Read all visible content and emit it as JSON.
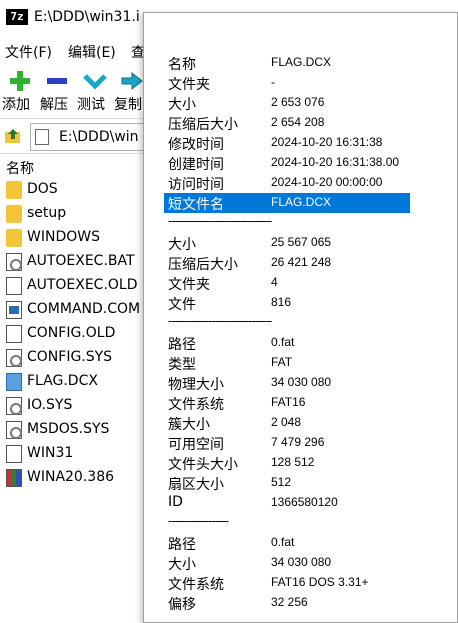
{
  "window": {
    "icon_text": "7z",
    "title": "E:\\DDD\\win31.i"
  },
  "menu": [
    "文件(F)",
    "编辑(E)",
    "查"
  ],
  "toolbar": [
    {
      "label": "添加",
      "icon": "add-icon",
      "color": "#2db52d"
    },
    {
      "label": "解压",
      "icon": "extract-icon",
      "color": "#2a3fc9"
    },
    {
      "label": "测试",
      "icon": "test-icon",
      "color": "#19a7c9"
    },
    {
      "label": "复制",
      "icon": "copy-icon",
      "color": "#19a7c9"
    }
  ],
  "address": {
    "path": "E:\\DDD\\win"
  },
  "filelist": {
    "header": "名称",
    "items": [
      {
        "name": "DOS",
        "icon": "folder-icon"
      },
      {
        "name": "setup",
        "icon": "folder-icon"
      },
      {
        "name": "WINDOWS",
        "icon": "folder-icon"
      },
      {
        "name": "AUTOEXEC.BAT",
        "icon": "settings-file-icon"
      },
      {
        "name": "AUTOEXEC.OLD",
        "icon": "file-icon"
      },
      {
        "name": "COMMAND.COM",
        "icon": "application-file-icon"
      },
      {
        "name": "CONFIG.OLD",
        "icon": "file-icon"
      },
      {
        "name": "CONFIG.SYS",
        "icon": "settings-file-icon"
      },
      {
        "name": "FLAG.DCX",
        "icon": "image-file-icon"
      },
      {
        "name": "IO.SYS",
        "icon": "settings-file-icon"
      },
      {
        "name": "MSDOS.SYS",
        "icon": "settings-file-icon"
      },
      {
        "name": "WIN31",
        "icon": "file-icon"
      },
      {
        "name": "WINA20.386",
        "icon": "archive-file-icon"
      }
    ]
  },
  "properties": {
    "file": [
      {
        "key": "名称",
        "value": "FLAG.DCX"
      },
      {
        "key": "文件夹",
        "value": "-"
      },
      {
        "key": "大小",
        "value": "2 653 076"
      },
      {
        "key": "压缩后大小",
        "value": "2 654 208"
      },
      {
        "key": "修改时间",
        "value": "2024-10-20 16:31:38"
      },
      {
        "key": "创建时间",
        "value": "2024-10-20 16:31:38.00"
      },
      {
        "key": "访问时间",
        "value": "2024-10-20 00:00:00"
      },
      {
        "key": "短文件名",
        "value": "FLAG.DCX",
        "selected": true
      }
    ],
    "sep1": "-------------------------------",
    "totals": [
      {
        "key": "大小",
        "value": "25 567 065"
      },
      {
        "key": "压缩后大小",
        "value": "26 421 248"
      },
      {
        "key": "文件夹",
        "value": "4"
      },
      {
        "key": "文件",
        "value": "816"
      }
    ],
    "sep2": "-------------------------------",
    "archive": [
      {
        "key": "路径",
        "value": "0.fat"
      },
      {
        "key": "类型",
        "value": "FAT"
      },
      {
        "key": "物理大小",
        "value": "34 030 080"
      },
      {
        "key": "文件系统",
        "value": "FAT16"
      },
      {
        "key": "簇大小",
        "value": "2 048"
      },
      {
        "key": "可用空间",
        "value": "7 479 296"
      },
      {
        "key": "文件头大小",
        "value": "128 512"
      },
      {
        "key": "扇区大小",
        "value": "512"
      },
      {
        "key": "ID",
        "value": "1366580120"
      }
    ],
    "sep3": "------------------",
    "volume": [
      {
        "key": "路径",
        "value": "0.fat"
      },
      {
        "key": "大小",
        "value": "34 030 080"
      },
      {
        "key": "文件系统",
        "value": "FAT16 DOS 3.31+"
      },
      {
        "key": "偏移",
        "value": "32 256"
      }
    ]
  },
  "colors": {
    "selection": "#0078d7",
    "folder": "#f3c33a"
  }
}
